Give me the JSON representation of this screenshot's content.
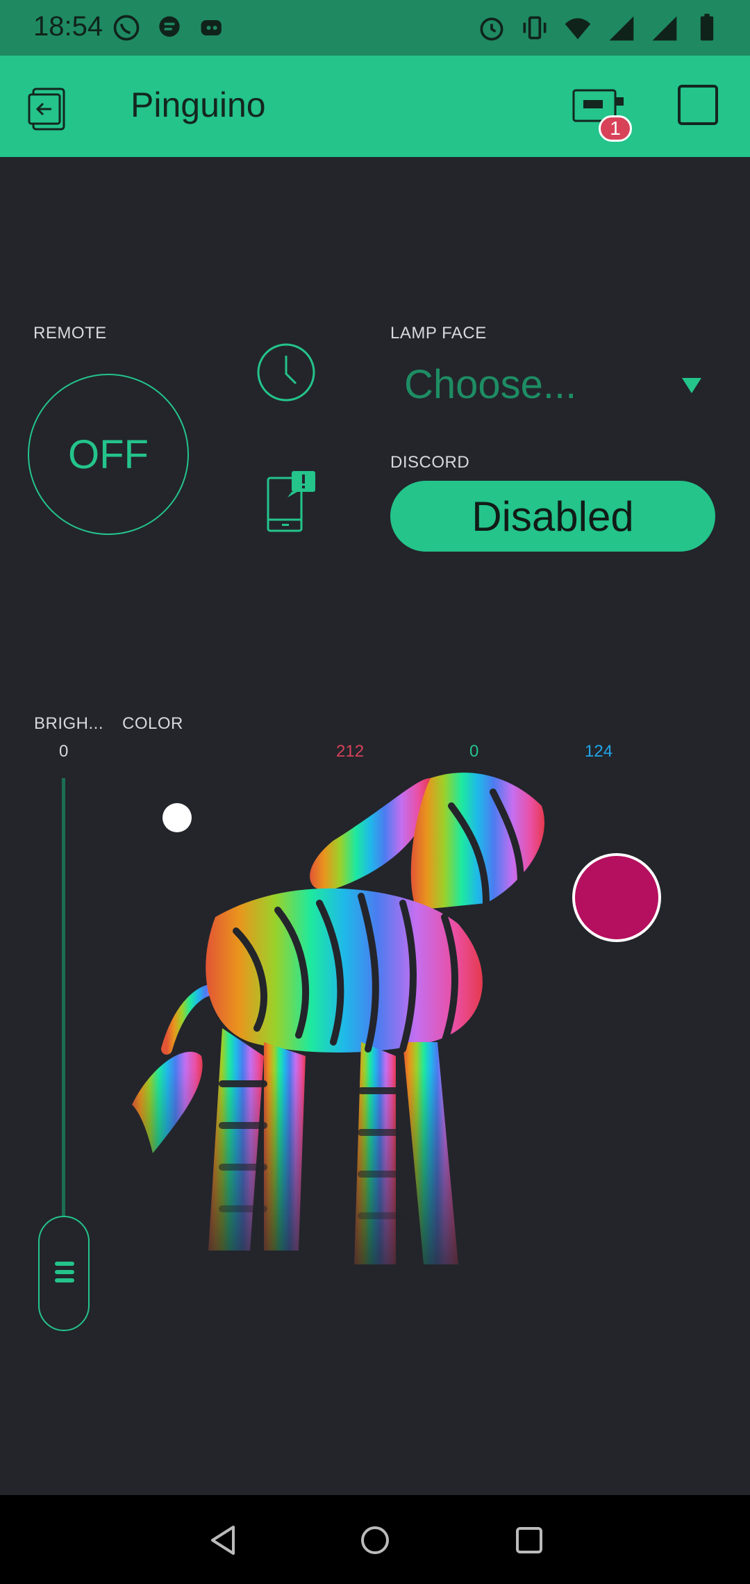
{
  "status": {
    "time": "18:54"
  },
  "app": {
    "title": "Pinguino",
    "badge_count": "1"
  },
  "remote": {
    "label": "REMOTE",
    "state": "OFF"
  },
  "lamp_face": {
    "label": "LAMP FACE",
    "value": "Choose..."
  },
  "discord": {
    "label": "DISCORD",
    "button": "Disabled"
  },
  "brightness": {
    "label": "BRIGH...",
    "value": "0",
    "level": 0
  },
  "color": {
    "label": "COLOR",
    "r": "212",
    "g": "0",
    "b": "124",
    "r_color": "#d74259",
    "g_color": "#24c48b",
    "b_color": "#23a5e8",
    "selected": "#b4105f"
  },
  "icons": [
    "whatsapp-icon",
    "chat-icon",
    "discord-icon",
    "alarm-icon",
    "vibrate-icon",
    "wifi-icon",
    "signal-icon",
    "battery-icon",
    "exit-icon",
    "device-icon",
    "clock-icon",
    "phone-notification-icon",
    "back-icon",
    "home-icon",
    "recents-icon"
  ],
  "theme": {
    "accent": "#24c48b",
    "background": "#23252b"
  }
}
